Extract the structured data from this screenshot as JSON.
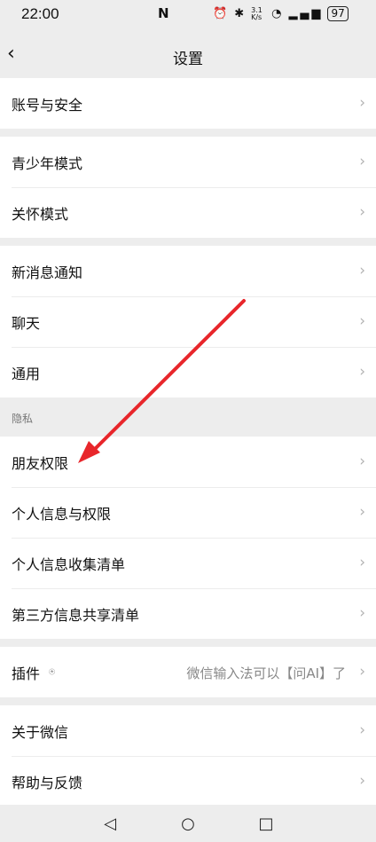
{
  "status_bar": {
    "time": "22:00",
    "nfc": "N",
    "speed": "3.1 K/s",
    "battery": "97"
  },
  "header": {
    "title": "设置"
  },
  "groups": [
    {
      "items": [
        {
          "label": "账号与安全"
        }
      ]
    },
    {
      "items": [
        {
          "label": "青少年模式"
        },
        {
          "label": "关怀模式"
        }
      ]
    },
    {
      "items": [
        {
          "label": "新消息通知"
        },
        {
          "label": "聊天"
        },
        {
          "label": "通用"
        }
      ]
    }
  ],
  "privacy_section": {
    "label": "隐私",
    "items": [
      {
        "label": "朋友权限"
      },
      {
        "label": "个人信息与权限"
      },
      {
        "label": "个人信息收集清单"
      },
      {
        "label": "第三方信息共享清单"
      }
    ]
  },
  "plugin_row": {
    "label": "插件",
    "value": "微信输入法可以【问AI】了"
  },
  "about_group": {
    "items": [
      {
        "label": "关于微信"
      },
      {
        "label": "帮助与反馈"
      }
    ]
  },
  "annotation": {
    "color": "#e8262b",
    "target": "朋友权限"
  }
}
